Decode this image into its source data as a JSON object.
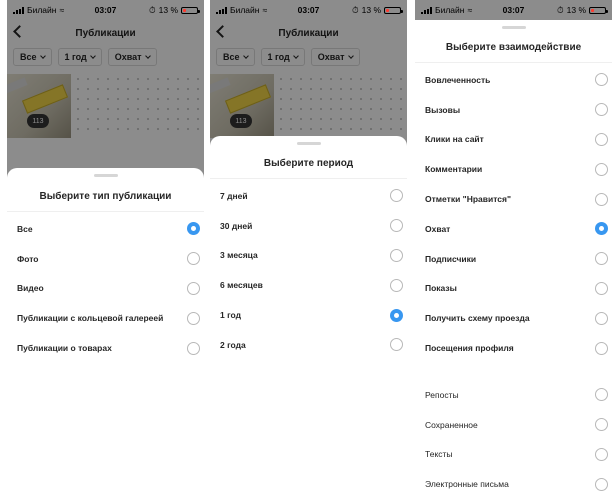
{
  "status_bar": {
    "carrier": "Билайн",
    "time": "03:07",
    "battery": "13 %"
  },
  "nav": {
    "title": "Публикации"
  },
  "filters": [
    "Все",
    "1 год",
    "Охват"
  ],
  "post": {
    "count_badge": "113"
  },
  "sheets": {
    "publication_type": {
      "title": "Выберите тип публикации",
      "options": [
        {
          "label": "Все",
          "selected": true
        },
        {
          "label": "Фото",
          "selected": false
        },
        {
          "label": "Видео",
          "selected": false
        },
        {
          "label": "Публикации с кольцевой галереей",
          "selected": false
        },
        {
          "label": "Публикации о товарах",
          "selected": false
        }
      ]
    },
    "period": {
      "title": "Выберите период",
      "options": [
        {
          "label": "7 дней",
          "selected": false
        },
        {
          "label": "30 дней",
          "selected": false
        },
        {
          "label": "3 месяца",
          "selected": false
        },
        {
          "label": "6 месяцев",
          "selected": false
        },
        {
          "label": "1 год",
          "selected": true
        },
        {
          "label": "2 года",
          "selected": false
        }
      ]
    },
    "interaction": {
      "title": "Выберите взаимодействие",
      "options": [
        {
          "label": "Вовлеченность",
          "selected": false
        },
        {
          "label": "Вызовы",
          "selected": false
        },
        {
          "label": "Клики на сайт",
          "selected": false
        },
        {
          "label": "Комментарии",
          "selected": false
        },
        {
          "label": "Отметки \"Нравится\"",
          "selected": false
        },
        {
          "label": "Охват",
          "selected": true
        },
        {
          "label": "Подписчики",
          "selected": false
        },
        {
          "label": "Показы",
          "selected": false
        },
        {
          "label": "Получить схему проезда",
          "selected": false
        },
        {
          "label": "Посещения профиля",
          "selected": false
        }
      ],
      "more_options": [
        {
          "label": "Репосты",
          "selected": false
        },
        {
          "label": "Сохраненное",
          "selected": false
        },
        {
          "label": "Тексты",
          "selected": false
        },
        {
          "label": "Электронные письма",
          "selected": false
        }
      ]
    }
  },
  "colors": {
    "accent": "#3897f0",
    "overlay": "#000000",
    "text": "#262626"
  }
}
